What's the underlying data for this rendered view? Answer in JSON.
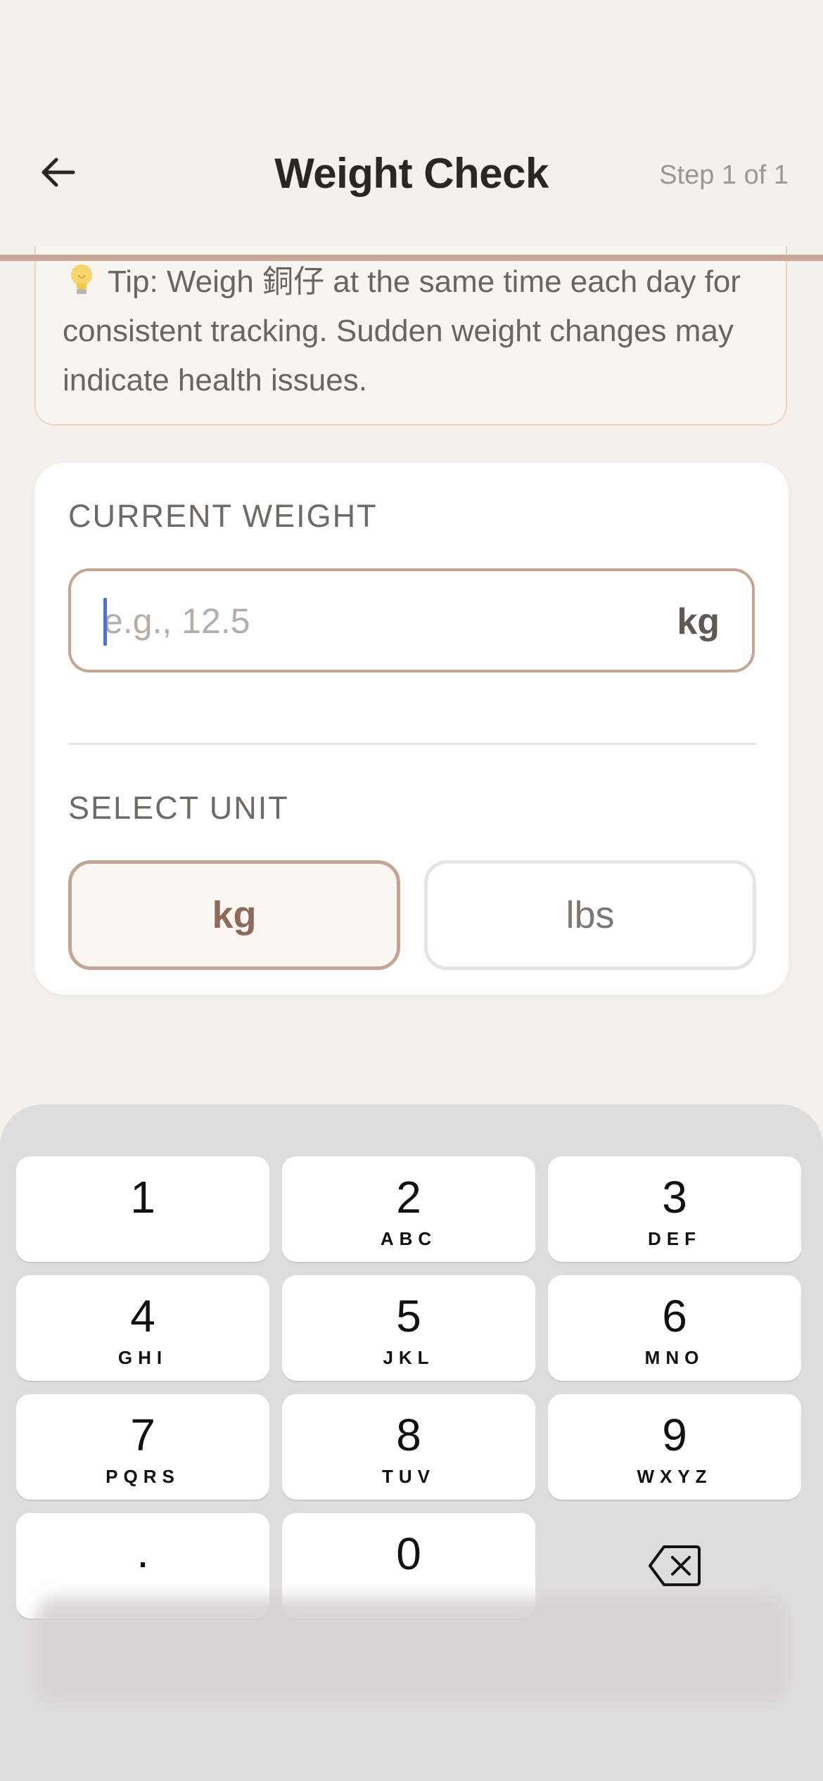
{
  "header": {
    "title": "Weight Check",
    "step": "Step 1 of 1"
  },
  "tip": {
    "icon": "lightbulb-icon",
    "text": "Tip: Weigh 銅仔 at the same time each day for consistent tracking. Sudden weight changes may indicate health issues."
  },
  "weight": {
    "label": "CURRENT WEIGHT",
    "placeholder": "e.g., 12.5",
    "value": "",
    "unit_suffix": "kg"
  },
  "unit_select": {
    "label": "SELECT UNIT",
    "options": [
      "kg",
      "lbs"
    ],
    "selected": "kg"
  },
  "keyboard": {
    "keys": [
      {
        "num": "1",
        "letters": ""
      },
      {
        "num": "2",
        "letters": "ABC"
      },
      {
        "num": "3",
        "letters": "DEF"
      },
      {
        "num": "4",
        "letters": "GHI"
      },
      {
        "num": "5",
        "letters": "JKL"
      },
      {
        "num": "6",
        "letters": "MNO"
      },
      {
        "num": "7",
        "letters": "PQRS"
      },
      {
        "num": "8",
        "letters": "TUV"
      },
      {
        "num": "9",
        "letters": "WXYZ"
      },
      {
        "num": ".",
        "letters": ""
      },
      {
        "num": "0",
        "letters": ""
      }
    ],
    "delete_icon": "backspace-icon"
  },
  "colors": {
    "background": "#f4f0eb",
    "accent": "#c4a596",
    "selected_unit_text": "#8c6a5c",
    "caret": "#4a6fe0"
  }
}
